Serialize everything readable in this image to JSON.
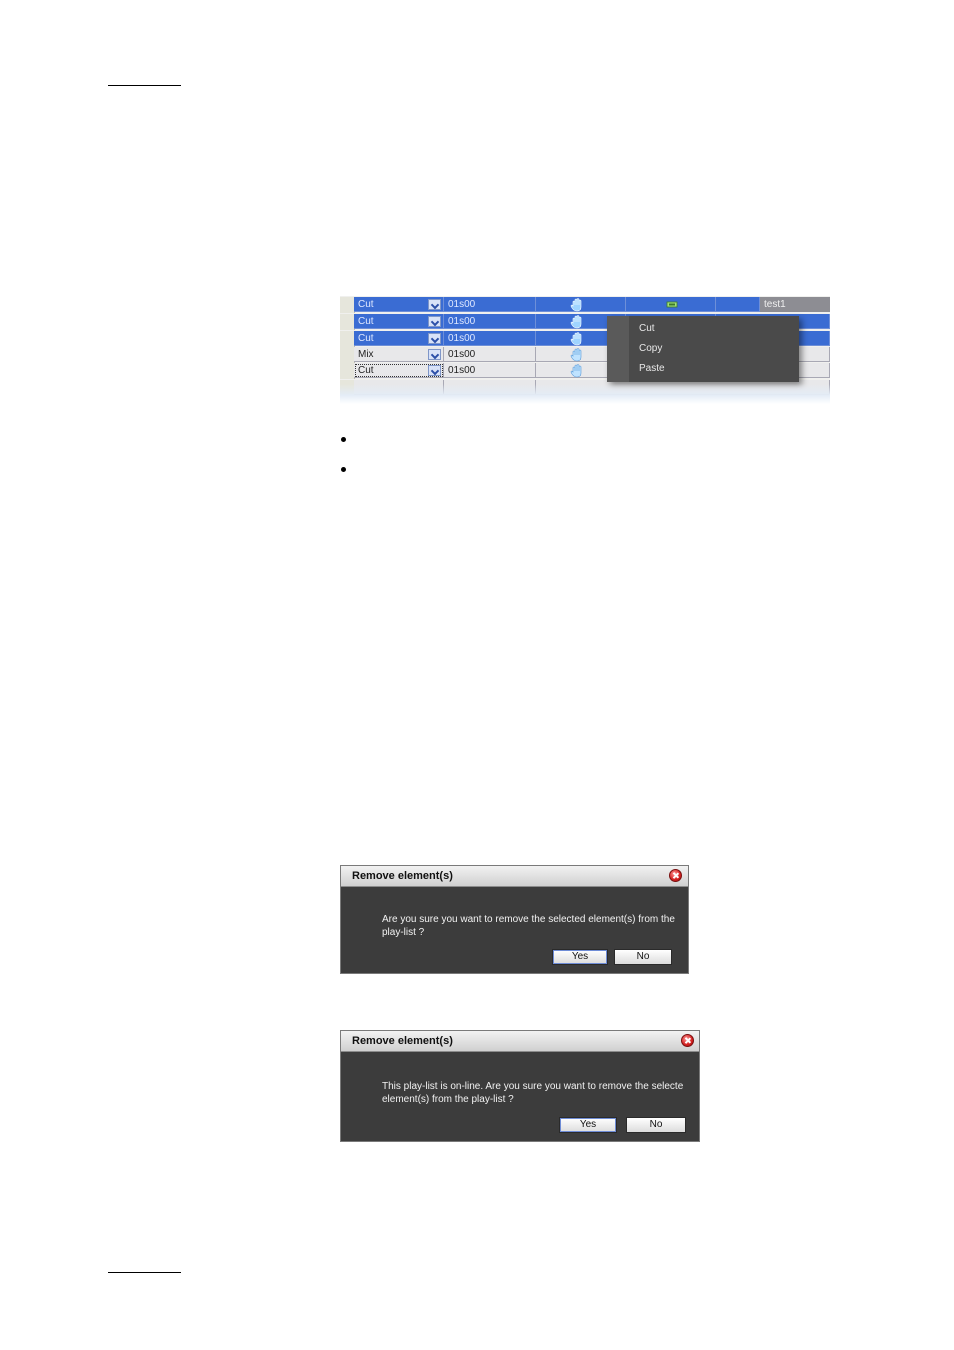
{
  "playlist_grid": {
    "rows": [
      {
        "transition": "Cut",
        "duration": "01s00",
        "selected": true
      },
      {
        "transition": "Cut",
        "duration": "01s00",
        "selected": true
      },
      {
        "transition": "Cut",
        "duration": "01s00",
        "selected": true
      },
      {
        "transition": "Mix",
        "duration": "01s00",
        "selected": false
      },
      {
        "transition": "Cut",
        "duration": "01s00",
        "selected": false
      }
    ],
    "name_cell": "test1",
    "context_menu": [
      "Cut",
      "Copy",
      "Paste"
    ],
    "colors": {
      "selected": "#3a6cd3",
      "menu": "#4a4a4a"
    }
  },
  "dialog1": {
    "title": "Remove element(s)",
    "message_line1": "Are you sure you want to remove the selected element(s) from the",
    "message_line2": "play-list ?",
    "yes": "Yes",
    "no": "No"
  },
  "dialog2": {
    "title": "Remove element(s)",
    "message_line1": "This play-list is on-line.  Are you sure you want to remove the selecte",
    "message_line2": "element(s) from the play-list ?",
    "yes": "Yes",
    "no": "No"
  }
}
